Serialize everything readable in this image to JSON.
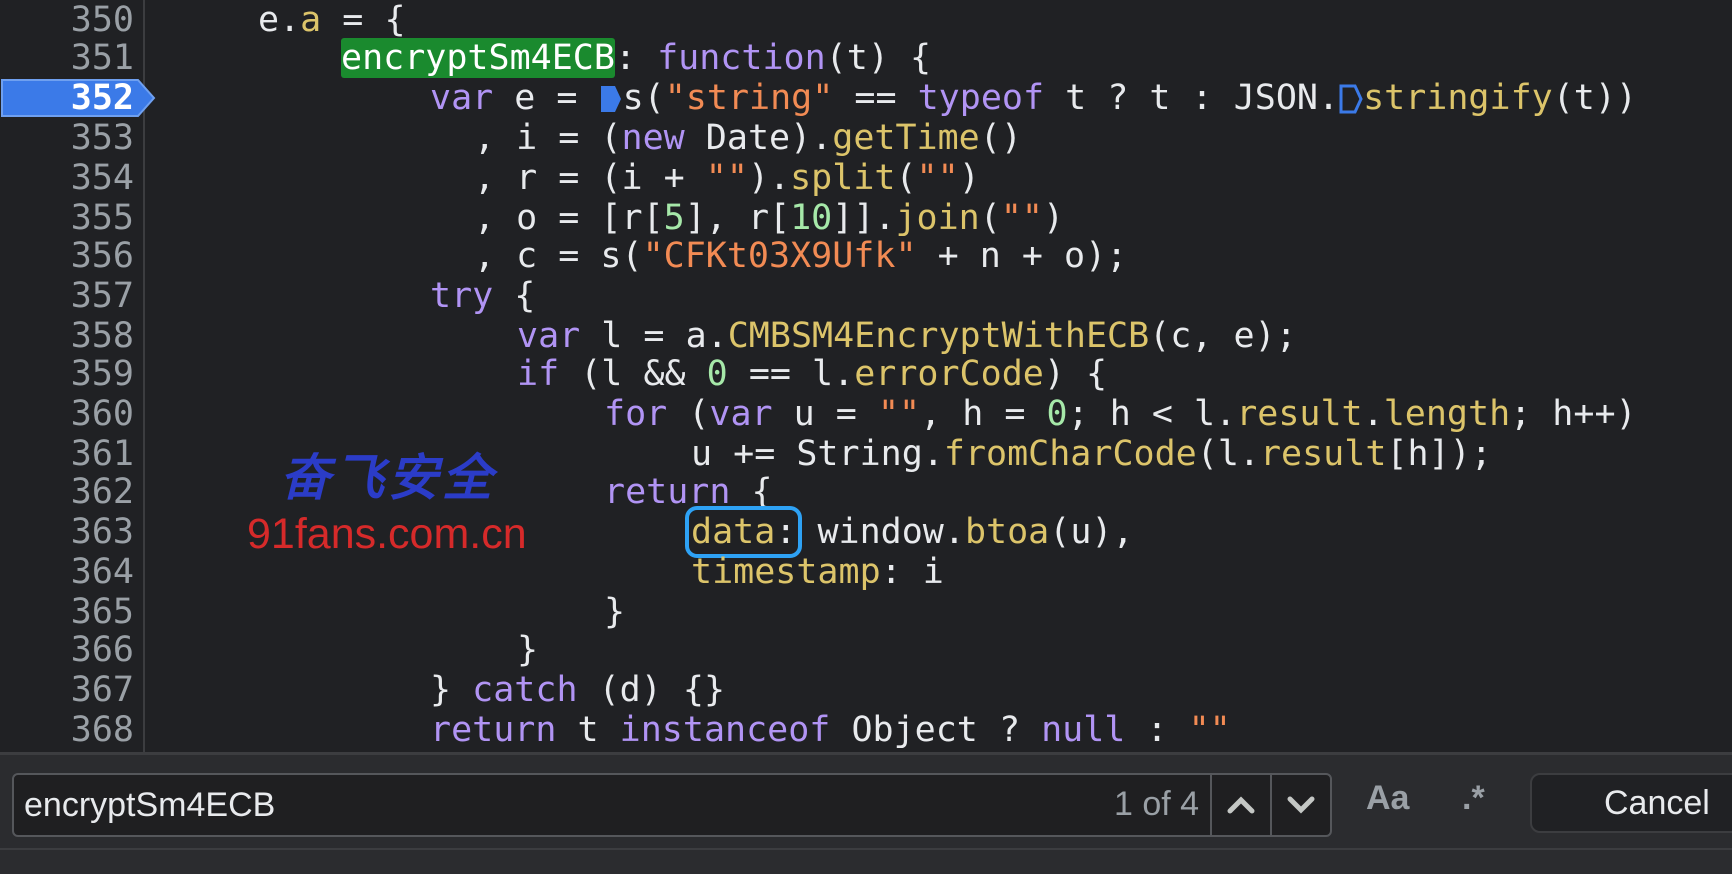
{
  "editor": {
    "line_numbers": [
      "350",
      "351",
      "352",
      "353",
      "354",
      "355",
      "356",
      "357",
      "358",
      "359",
      "360",
      "361",
      "362",
      "363",
      "364",
      "365",
      "366",
      "367",
      "368"
    ],
    "active_line": "352",
    "colors": {
      "keyword": "#b194f4",
      "function": "#dcc46a",
      "string": "#f28b54",
      "number": "#a6e8a9",
      "match_bg": "#1a8a2e",
      "breakpoint": "#3b7ae8"
    }
  },
  "code": {
    "l350": {
      "t1": "e.",
      "a": "a",
      "t2": " = {"
    },
    "l351": {
      "match": "encryptSm4ECB",
      "t1": ": ",
      "kw": "function",
      "t2": "(t) {"
    },
    "l352": {
      "kw1": "var",
      "t1": " e = ",
      "t2": "s(",
      "s1": "\"string\"",
      "t3": " == ",
      "kw2": "typeof",
      "t4": " t ? t : JSON.",
      "f1": "stringify",
      "t5": "(t))"
    },
    "l353": {
      "t1": ", i = (",
      "kw": "new",
      "t2": " Date).",
      "f": "getTime",
      "t3": "()"
    },
    "l354": {
      "t1": ", r = (i + ",
      "s": "\"\"",
      "t2": ").",
      "f": "split",
      "t3": "(",
      "s2": "\"\"",
      "t4": ")"
    },
    "l355": {
      "t1": ", o = [r[",
      "n1": "5",
      "t2": "], r[",
      "n2": "10",
      "t3": "]].",
      "f": "join",
      "t4": "(",
      "s": "\"\"",
      "t5": ")"
    },
    "l356": {
      "t1": ", c = s(",
      "s": "\"CFKt03X9Ufk\"",
      "t2": " + n + o);"
    },
    "l357": {
      "kw": "try",
      "t1": " {"
    },
    "l358": {
      "kw": "var",
      "t1": " l = a.",
      "f": "CMBSM4EncryptWithECB",
      "t2": "(c, e);"
    },
    "l359": {
      "kw": "if",
      "t1": " (l && ",
      "n": "0",
      "t2": " == l.",
      "p": "errorCode",
      "t3": ") {"
    },
    "l360": {
      "kw1": "for",
      "t1": " (",
      "kw2": "var",
      "t2": " u = ",
      "s": "\"\"",
      "t3": ", h = ",
      "n": "0",
      "t4": "; h < l.",
      "p1": "result",
      "t5": ".",
      "p2": "length",
      "t6": "; h++)"
    },
    "l361": {
      "t1": "u += String.",
      "f": "fromCharCode",
      "t2": "(l.",
      "p": "result",
      "t3": "[h]);"
    },
    "l362": {
      "kw": "return",
      "t1": " {"
    },
    "l363": {
      "p": "data",
      "t1": ":",
      "t2": " window.",
      "f": "btoa",
      "t3": "(u),"
    },
    "l364": {
      "p": "timestamp",
      "t1": ": i"
    },
    "l365": {
      "t1": "}"
    },
    "l366": {
      "t1": "}"
    },
    "l367": {
      "t1": "} ",
      "kw": "catch",
      "t2": " (d) {}"
    },
    "l368": {
      "kw1": "return",
      "t1": " t ",
      "kw2": "instanceof",
      "t2": " Object ? ",
      "kw3": "null",
      "t3": " : ",
      "s": "\"\""
    }
  },
  "watermark": {
    "cn": "奋飞安全",
    "url": "91fans.com.cn"
  },
  "findbar": {
    "query": "encryptSm4ECB",
    "count": "1 of 4",
    "match_case_label": "Aa",
    "regex_label": ".*",
    "cancel_label": "Cancel"
  }
}
